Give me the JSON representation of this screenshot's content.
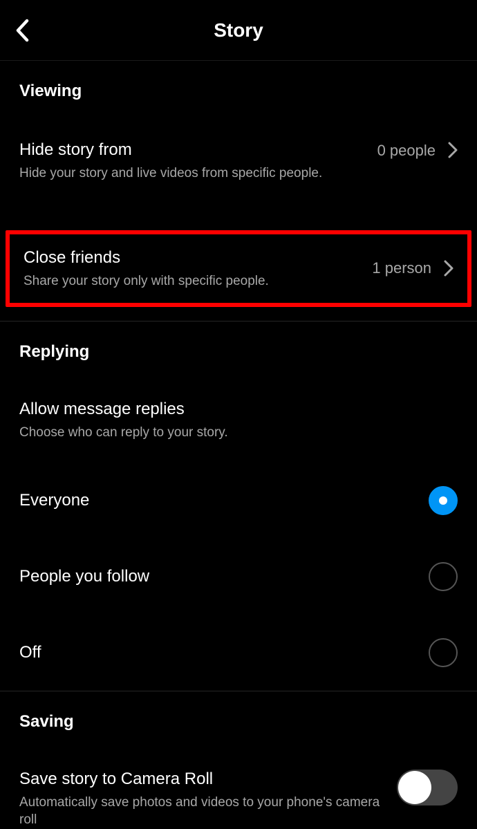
{
  "header": {
    "title": "Story"
  },
  "viewing": {
    "section_label": "Viewing",
    "hide_story": {
      "title": "Hide story from",
      "subtitle": "Hide your story and live videos from specific people.",
      "value": "0 people"
    },
    "close_friends": {
      "title": "Close friends",
      "subtitle": "Share your story only with specific people.",
      "value": "1 person"
    }
  },
  "replying": {
    "section_label": "Replying",
    "allow_replies": {
      "title": "Allow message replies",
      "subtitle": "Choose who can reply to your story."
    },
    "options": [
      {
        "label": "Everyone",
        "selected": true
      },
      {
        "label": "People you follow",
        "selected": false
      },
      {
        "label": "Off",
        "selected": false
      }
    ]
  },
  "saving": {
    "section_label": "Saving",
    "save_to_roll": {
      "title": "Save story to Camera Roll",
      "subtitle": "Automatically save photos and videos to your phone's camera roll",
      "enabled": false
    }
  }
}
